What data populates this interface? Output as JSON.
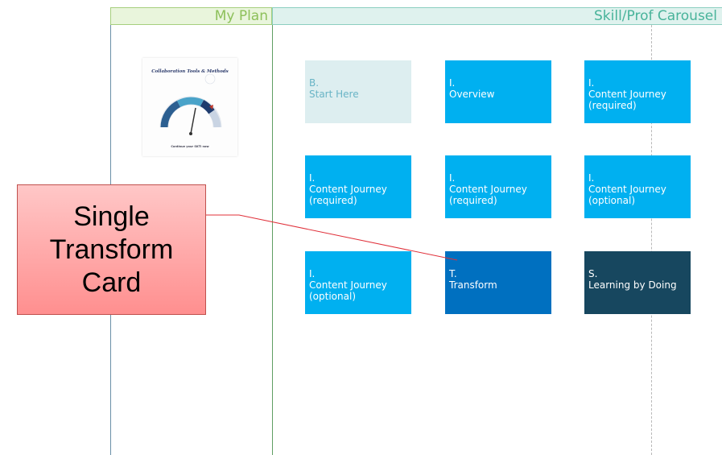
{
  "headers": {
    "my_plan": "My Plan",
    "skill_carousel": "Skill/Prof Carousel"
  },
  "thumbnail": {
    "title": "Collaboration Tools & Methods",
    "caption": "Continue your SKTI now"
  },
  "cards": [
    {
      "letter": "B.",
      "label": "Start Here",
      "style": "light"
    },
    {
      "letter": "I.",
      "label": "Overview",
      "style": "blue"
    },
    {
      "letter": "I.",
      "label": "Content Journey\n(required)",
      "style": "blue"
    },
    {
      "letter": "I.",
      "label": "Content Journey\n(required)",
      "style": "blue"
    },
    {
      "letter": "I.",
      "label": "Content Journey\n(required)",
      "style": "blue"
    },
    {
      "letter": "I.",
      "label": "Content Journey\n(optional)",
      "style": "blue"
    },
    {
      "letter": "I.",
      "label": "Content Journey\n(optional)",
      "style": "blue"
    },
    {
      "letter": "T.",
      "label": "Transform",
      "style": "medium"
    },
    {
      "letter": "S.",
      "label": "Learning by Doing",
      "style": "dark"
    }
  ],
  "callout": {
    "text": "Single\nTransform\nCard"
  },
  "colors": {
    "card_light": "#ddeef0",
    "card_blue": "#00b0f0",
    "card_transform": "#0070c0",
    "card_doing": "#17475f",
    "callout_fill": "#ff9f9f",
    "callout_border": "#c0504d"
  }
}
